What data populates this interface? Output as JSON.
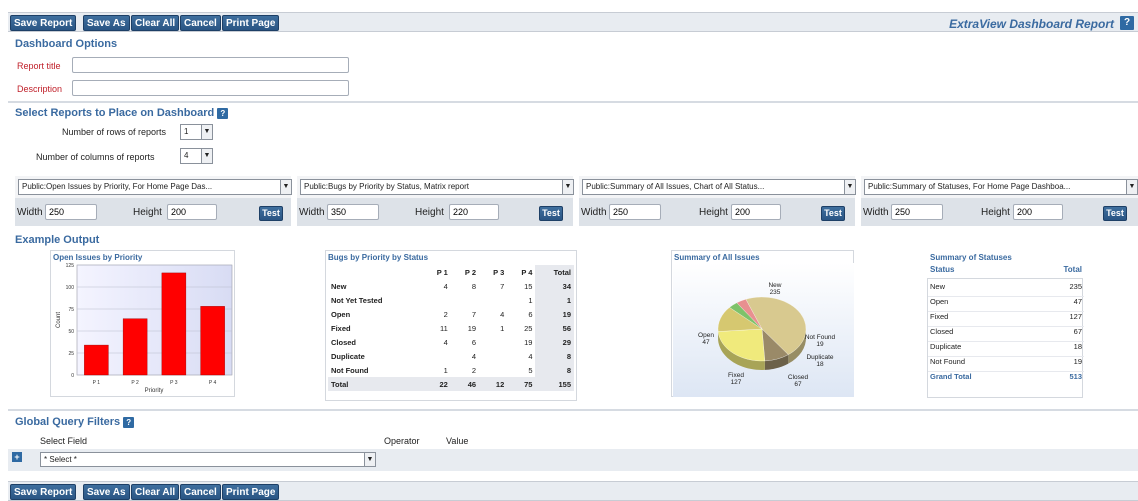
{
  "toolbar": {
    "buttons": [
      "Save Report",
      "Save As",
      "Clear All",
      "Cancel",
      "Print Page"
    ],
    "app_title": "ExtraView Dashboard Report",
    "help": "?"
  },
  "dashboard_options": {
    "title": "Dashboard Options",
    "report_title_label": "Report title",
    "report_title_value": "",
    "description_label": "Description",
    "description_value": ""
  },
  "select_reports": {
    "title": "Select Reports to Place on Dashboard",
    "rows_label": "Number of rows of reports",
    "rows_value": "1",
    "cols_label": "Number of columns of reports",
    "cols_value": "4",
    "columns": [
      {
        "report": "Public:Open Issues by Priority, For Home Page Das...",
        "width_label": "Width",
        "width": "250",
        "height_label": "Height",
        "height": "200",
        "test": "Test"
      },
      {
        "report": "Public:Bugs by Priority by Status, Matrix report",
        "width_label": "Width",
        "width": "350",
        "height_label": "Height",
        "height": "220",
        "test": "Test"
      },
      {
        "report": "Public:Summary of All Issues, Chart of All Status...",
        "width_label": "Width",
        "width": "250",
        "height_label": "Height",
        "height": "200",
        "test": "Test"
      },
      {
        "report": "Public:Summary of Statuses, For Home Page Dashboa...",
        "width_label": "Width",
        "width": "250",
        "height_label": "Height",
        "height": "200",
        "test": "Test"
      }
    ]
  },
  "example_output": {
    "title": "Example Output",
    "bar_title": "Open Issues by Priority",
    "matrix_title": "Bugs by Priority by Status",
    "pie_title": "Summary of All Issues",
    "status_title": "Summary of Statuses"
  },
  "chart_data": [
    {
      "type": "bar",
      "title": "Open Issues by Priority",
      "xlabel": "Priority",
      "ylabel": "Count",
      "categories": [
        "P 1",
        "P 2",
        "P 3",
        "P 4"
      ],
      "values": [
        34,
        64,
        116,
        78
      ],
      "ylim": [
        0,
        125
      ],
      "yticks": [
        "0",
        "25",
        "50",
        "75",
        "100",
        "125"
      ],
      "color": "#ff0000"
    },
    {
      "type": "pie",
      "title": "Summary of All Issues",
      "labels": [
        "New",
        "Open",
        "Fixed",
        "Closed",
        "Duplicate",
        "Not Found"
      ],
      "values": [
        235,
        47,
        127,
        67,
        18,
        19
      ],
      "display": [
        {
          "name": "New",
          "value": "235"
        },
        {
          "name": "Open",
          "value": "47"
        },
        {
          "name": "Fixed",
          "value": "127"
        },
        {
          "name": "Closed",
          "value": "67"
        },
        {
          "name": "Duplicate",
          "value": "18"
        },
        {
          "name": "Not Found",
          "value": "19"
        }
      ],
      "colors": [
        "#d8c98f",
        "#9a8a68",
        "#f0ea7c",
        "#d6c870",
        "#7ec26a",
        "#e89090"
      ]
    }
  ],
  "matrix": {
    "headers": [
      "",
      "P 1",
      "P 2",
      "P 3",
      "P 4",
      "Total"
    ],
    "rows": [
      [
        "New",
        "4",
        "8",
        "7",
        "15",
        "34"
      ],
      [
        "Not Yet Tested",
        "",
        "",
        "",
        "1",
        "1"
      ],
      [
        "Open",
        "2",
        "7",
        "4",
        "6",
        "19"
      ],
      [
        "Fixed",
        "11",
        "19",
        "1",
        "25",
        "56"
      ],
      [
        "Closed",
        "4",
        "6",
        "",
        "19",
        "29"
      ],
      [
        "Duplicate",
        "",
        "4",
        "",
        "4",
        "8"
      ],
      [
        "Not Found",
        "1",
        "2",
        "",
        "5",
        "8"
      ],
      [
        "Total",
        "22",
        "46",
        "12",
        "75",
        "155"
      ]
    ]
  },
  "status_summary": {
    "headers": [
      "Status",
      "Total"
    ],
    "rows": [
      [
        "New",
        "235"
      ],
      [
        "Open",
        "47"
      ],
      [
        "Fixed",
        "127"
      ],
      [
        "Closed",
        "67"
      ],
      [
        "Duplicate",
        "18"
      ],
      [
        "Not Found",
        "19"
      ]
    ],
    "grand_total_label": "Grand Total",
    "grand_total": "513"
  },
  "global_filters": {
    "title": "Global Query Filters",
    "select_field_label": "Select Field",
    "operator_label": "Operator",
    "value_label": "Value",
    "select_value": "* Select *",
    "add_icon": "+"
  }
}
